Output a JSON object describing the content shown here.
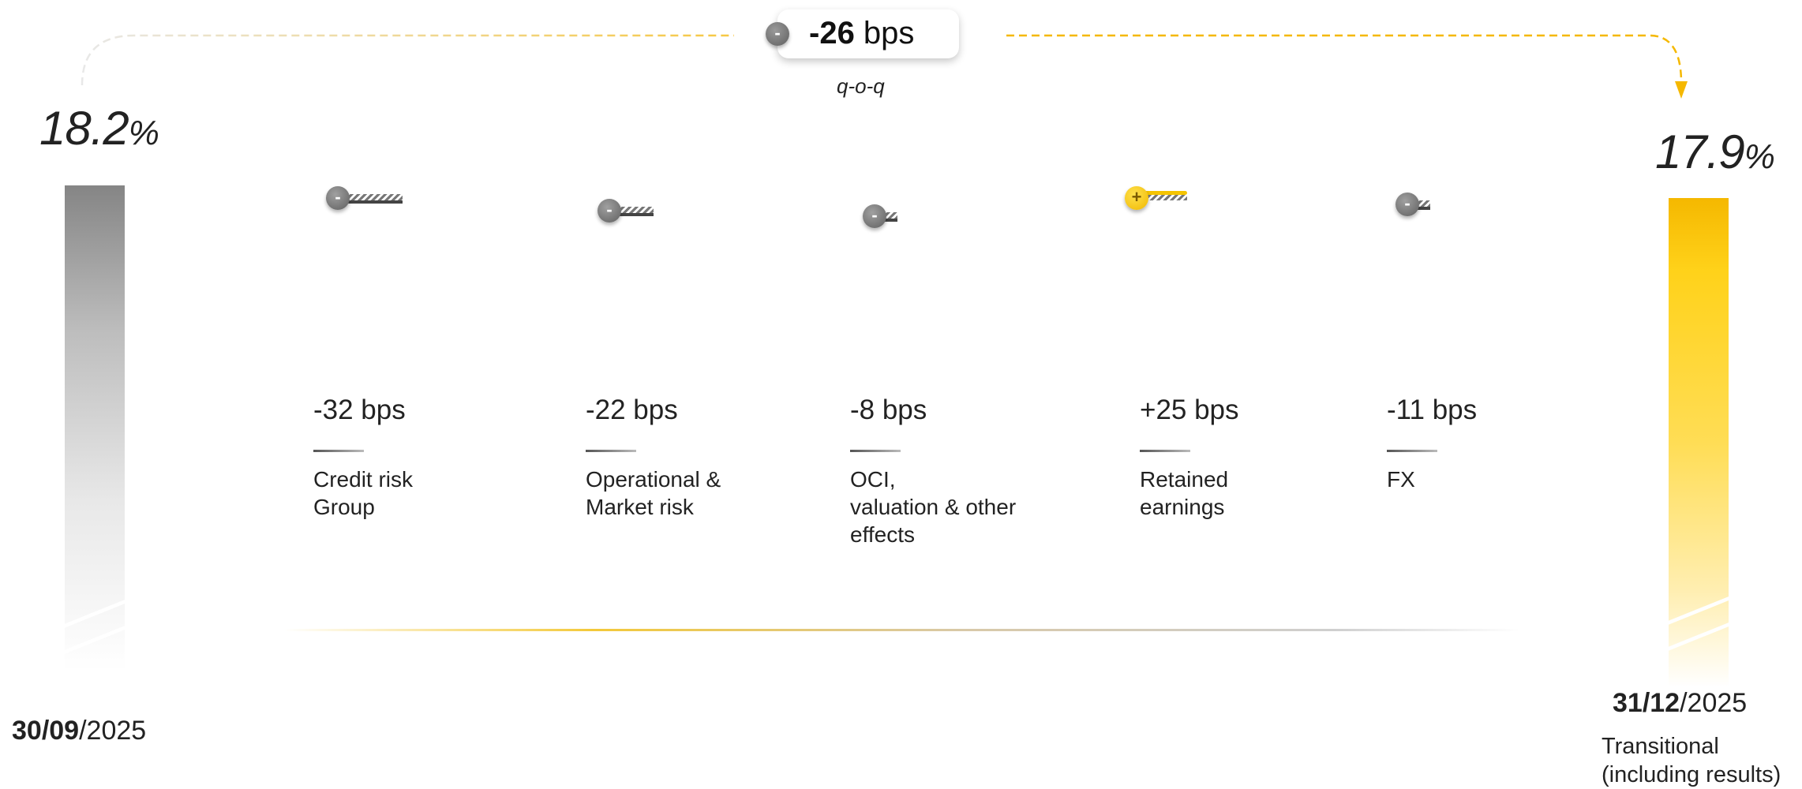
{
  "summary": {
    "sign": "-",
    "value_bold": "-26",
    "value_unit": " bps",
    "period": "q-o-q"
  },
  "start": {
    "value": "18.2",
    "unit": "%",
    "date_bold": "30/09",
    "date_rest": "/2025"
  },
  "end": {
    "value": "17.9",
    "unit": "%",
    "date_bold": "31/12",
    "date_rest": "/2025",
    "caption_line1": "Transitional",
    "caption_line2": "(including results)"
  },
  "contributions": [
    {
      "sign": "-",
      "value": "-32 bps",
      "label_lines": [
        "Credit risk",
        "Group"
      ]
    },
    {
      "sign": "-",
      "value": "-22 bps",
      "label_lines": [
        "Operational &",
        "Market risk"
      ]
    },
    {
      "sign": "-",
      "value": "-8 bps",
      "label_lines": [
        "OCI,",
        "valuation & other",
        "effects"
      ]
    },
    {
      "sign": "+",
      "value": "+25 bps",
      "label_lines": [
        "Retained",
        "earnings"
      ]
    },
    {
      "sign": "-",
      "value": "-11 bps",
      "label_lines": [
        "FX"
      ]
    }
  ],
  "colors": {
    "accent": "#f5b800",
    "grey": "#858585"
  },
  "chart_data": {
    "type": "bar",
    "categories": [
      "30/09/2025",
      "Credit risk Group",
      "Operational & Market risk",
      "OCI, valuation & other effects",
      "Retained earnings",
      "FX",
      "31/12/2025"
    ],
    "values": [
      18.2,
      -0.32,
      -0.22,
      -0.08,
      0.25,
      -0.11,
      17.9
    ],
    "title": "",
    "xlabel": "",
    "ylabel": ""
  }
}
